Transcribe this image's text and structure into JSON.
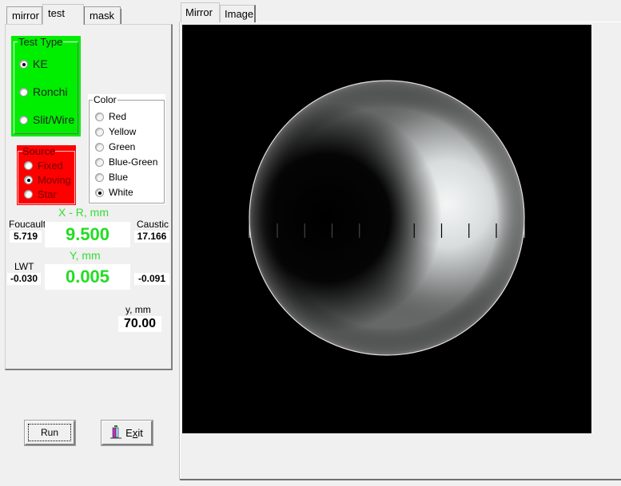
{
  "left_tabs": [
    {
      "label": "mirror",
      "active": false
    },
    {
      "label": "test",
      "active": true
    },
    {
      "label": "mask",
      "active": false
    }
  ],
  "test_type": {
    "legend": "Test Type",
    "color": "#00ee00",
    "options": [
      {
        "label": "KE",
        "selected": true
      },
      {
        "label": "Ronchi",
        "selected": false
      },
      {
        "label": "Slit/Wire",
        "selected": false
      }
    ]
  },
  "source": {
    "legend": "Source",
    "color": "#ff0000",
    "options": [
      {
        "label": "Fixed",
        "selected": false
      },
      {
        "label": "Moving",
        "selected": true
      },
      {
        "label": "Star",
        "selected": false
      }
    ]
  },
  "color_group": {
    "legend": "Color",
    "options": [
      {
        "label": "Red",
        "selected": false
      },
      {
        "label": "Yellow",
        "selected": false
      },
      {
        "label": "Green",
        "selected": false
      },
      {
        "label": "Blue-Green",
        "selected": false
      },
      {
        "label": "Blue",
        "selected": false
      },
      {
        "label": "White",
        "selected": true
      }
    ]
  },
  "readouts": {
    "x_label": "X - R, mm",
    "x_value": "9.500",
    "y_label": "Y, mm",
    "y_value": "0.005",
    "foucault_label": "Foucault",
    "foucault_value": "5.719",
    "caustic_label": "Caustic",
    "caustic_value": "17.166",
    "lwt_label": "LWT",
    "lwt_value": "-0.030",
    "lwt_right_value": "-0.091",
    "small_y_label": "y, mm",
    "small_y_value": "70.00"
  },
  "buttons": {
    "run": "Run",
    "exit_prefix": "E",
    "exit_mnemonic": "x",
    "exit_suffix": "it"
  },
  "right_tabs": [
    {
      "label": "Mirror",
      "active": true
    },
    {
      "label": "Image",
      "active": false
    }
  ],
  "mirror_view": {
    "description": "Simulated Foucault/KE test shadowgram of mirror",
    "scale_major_ticks": 9
  },
  "colors": {
    "readout_green": "#22dd22",
    "background": "#f0f0f0"
  }
}
